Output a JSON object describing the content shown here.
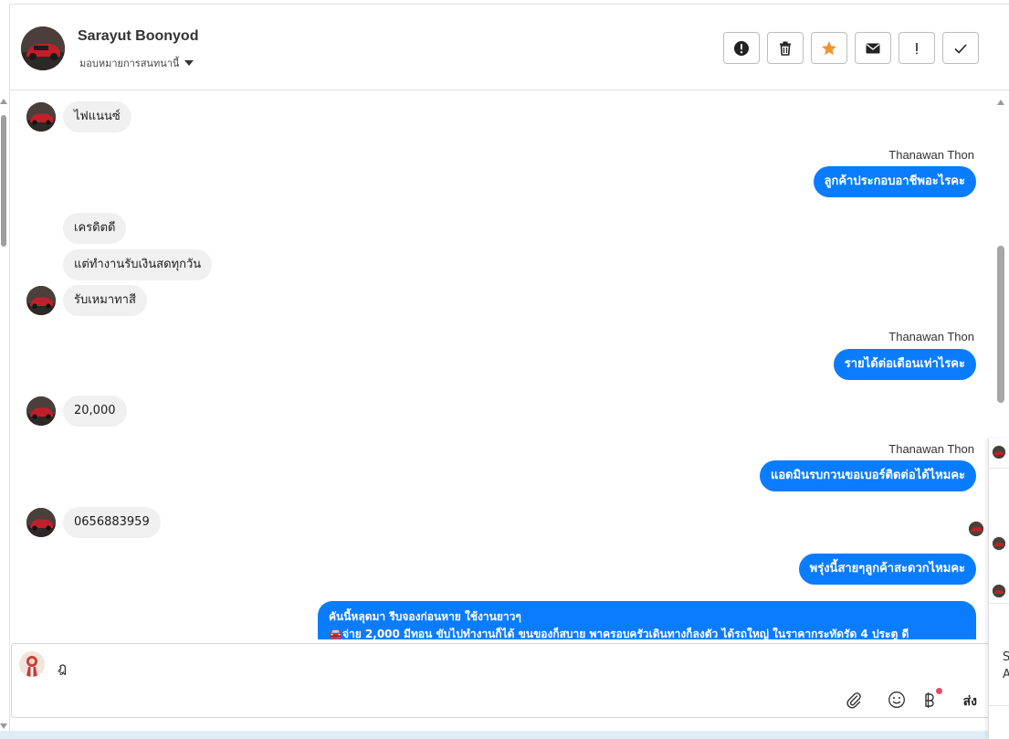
{
  "header": {
    "contact_name": "Sarayut Boonyod",
    "assign_label": "มอบหมายการสนทนานี้",
    "toolbar": [
      {
        "name": "report-spam-button",
        "icon": "alert-circle-icon"
      },
      {
        "name": "delete-button",
        "icon": "trash-icon"
      },
      {
        "name": "star-button",
        "icon": "star-icon",
        "color": "#f0932b"
      },
      {
        "name": "mark-unread-button",
        "icon": "envelope-icon"
      },
      {
        "name": "mark-important-button",
        "icon": "exclamation-icon"
      },
      {
        "name": "mark-done-button",
        "icon": "check-icon"
      }
    ]
  },
  "messages": [
    {
      "direction": "in",
      "text": "ไฟแนนซ์"
    },
    {
      "direction": "out",
      "sender": "Thanawan Thon",
      "text": "ลูกค้าประกอบอาชีพอะไรคะ"
    },
    {
      "direction": "in",
      "text": "เครดิตดี"
    },
    {
      "direction": "in",
      "text": "แต่ทำงานรับเงินสดทุกวัน"
    },
    {
      "direction": "in",
      "text": "รับเหมาทาสี"
    },
    {
      "direction": "out",
      "sender": "Thanawan Thon",
      "text": "รายได้ต่อเดือนเท่าไรคะ"
    },
    {
      "direction": "in",
      "text": "20,000"
    },
    {
      "direction": "out",
      "sender": "Thanawan Thon",
      "text": "แอดมินรบกวนขอเบอร์ติดต่อได้ไหมคะ"
    },
    {
      "direction": "in",
      "text": "0656883959"
    },
    {
      "direction": "out",
      "sender": "",
      "text": "พรุ่งนี้สายๆลูกค้าสะดวกไหมคะ"
    },
    {
      "direction": "out",
      "sender": "",
      "text_line1": "คันนี้หลุดมา รีบจองก่อนหาย ใช้งานยาวๆ",
      "text_line2": "🚘จ่าย 2,000 มีทอน ขับไปทำงานก็ได้ ขนของก็สบาย พาครอบครัวเดินทางก็ลงตัว ได้รถใหญ่ ในราคากระทัดรัด 4 ประตู ดี"
    }
  ],
  "composer": {
    "draft_text": "ฎ",
    "send_label": "ส่ง",
    "icons": [
      "attach-icon",
      "emoji-icon",
      "baht-icon"
    ]
  },
  "side_panel": {
    "fragment_1": "S",
    "fragment_2": "A"
  },
  "colors": {
    "outgoing_bubble": "#0a7cff",
    "incoming_bubble": "#f0f0f0",
    "accent_star": "#f0932b"
  }
}
